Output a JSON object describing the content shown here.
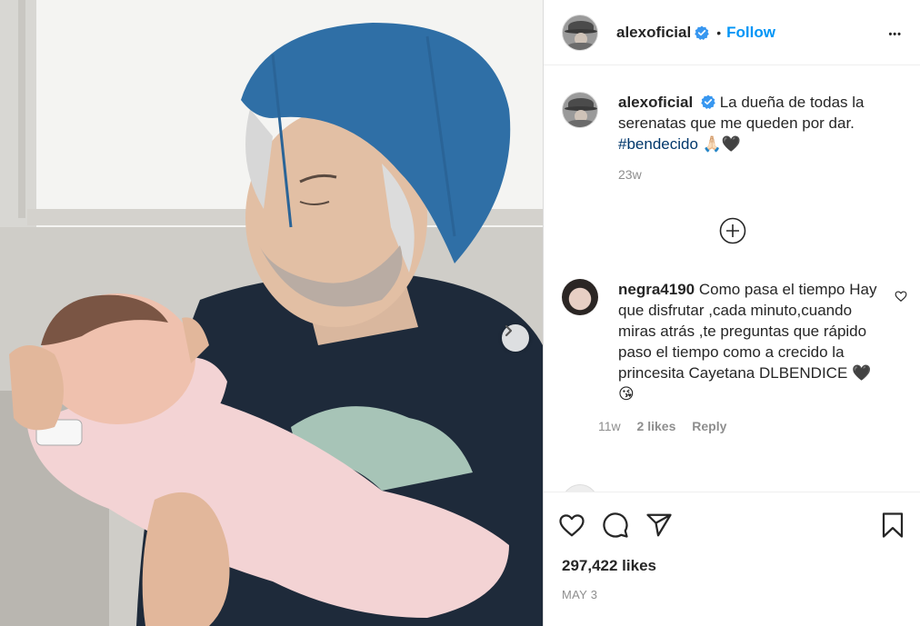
{
  "post": {
    "username": "alexoficial",
    "follow_label": "Follow",
    "dot": "•",
    "more_label": "•••"
  },
  "caption": {
    "username": "alexoficial",
    "text": "La dueña de todas la serenatas que me queden por dar.",
    "hashtag": "#bendecido",
    "emoji": "🙏🏻🖤",
    "time": "23w"
  },
  "comment": {
    "username": "negra4190",
    "text": "Como pasa el tiempo Hay que disfrutar ,cada minuto,cuando miras atrás ,te preguntas que rápido paso el tiempo como a crecido la princesita Cayetana DLBENDICE 🖤 😘",
    "time": "11w",
    "likes": "2 likes",
    "reply": "Reply"
  },
  "footer": {
    "likes": "297,422 likes",
    "date": "MAY 3"
  },
  "icons": {
    "verified": "verified-badge-icon",
    "more": "more-options-icon",
    "load_more": "plus-circle-icon",
    "like": "heart-icon",
    "comment": "comment-icon",
    "share": "share-icon",
    "save": "bookmark-icon",
    "next": "chevron-right-icon"
  },
  "colors": {
    "link_blue": "#0095f6",
    "hashtag": "#00376b",
    "muted": "#8e8e8e",
    "text": "#262626"
  }
}
